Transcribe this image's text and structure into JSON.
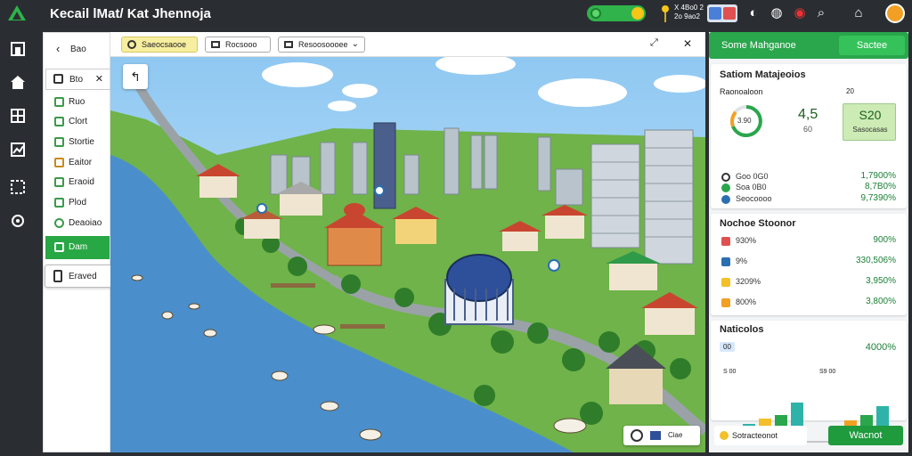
{
  "app": {
    "title": "Kecail lMat/  Kat Jhennoja"
  },
  "topbar": {
    "stat_lines": [
      "X 4Bo0 2",
      "2o 9ao2"
    ],
    "icons": [
      "coin-icon",
      "torch-icon",
      "media-icon",
      "moon-icon",
      "globe-icon",
      "notification-icon",
      "search-icon",
      "home-icon"
    ]
  },
  "rail": {
    "icons": [
      "building-icon",
      "home-icon",
      "grid-icon",
      "chart-icon",
      "map-grid-icon",
      "settings-icon"
    ]
  },
  "left_panel": {
    "back_label": "Bao",
    "header_label": "Bto",
    "items": [
      "Ruo",
      "Clort",
      "Stortie",
      "Eaitor",
      "Eraoid",
      "Plod",
      "Deaoiao"
    ],
    "active_item": "Dam",
    "floating_card": "Eraved"
  },
  "map_toolbar": {
    "tool1": "Saeocsaooe",
    "tool2": "Rocsooo",
    "tool3": "Resoosoooee"
  },
  "right_panel": {
    "header_title": "Some Mahganoe",
    "save_label": "Sactee",
    "system_card": {
      "title": "Satiom Matajeoios",
      "subtitle": "Raonoaloon",
      "corner": "20",
      "gauge_text": "3.90",
      "big_value": "4,5",
      "small_value": "60",
      "score_value": "S20",
      "score_sub": "Sasocasas",
      "rows": [
        {
          "label": "Soa 0B0",
          "value": "8,7B0%"
        },
        {
          "label": "Goo 0G0",
          "value": "1,7900%"
        },
        {
          "label": "Seocoooo",
          "value": "9,7390%"
        }
      ]
    },
    "market_card": {
      "title": "Nochoe Stoonor",
      "rows": [
        {
          "label": "930%",
          "value": "900%"
        },
        {
          "label": "9%",
          "value": "330,506%"
        },
        {
          "label": "3209%",
          "value": "3,950%"
        },
        {
          "label": "800%",
          "value": "3,800%"
        }
      ]
    },
    "stats_card": {
      "title": "Naticolos",
      "badge": "00",
      "total": "4000%",
      "left_label": "S 00",
      "right_label": "S9 00"
    },
    "footer_left": "Sotracteonot",
    "footer_btn": "Wacnot"
  },
  "map": {
    "legend": "Ciae"
  },
  "colors": {
    "accent_green": "#2aa64c",
    "topbar_bg": "#2a2e33",
    "water": "#4a8fcc",
    "sky": "#8fc8f2"
  }
}
